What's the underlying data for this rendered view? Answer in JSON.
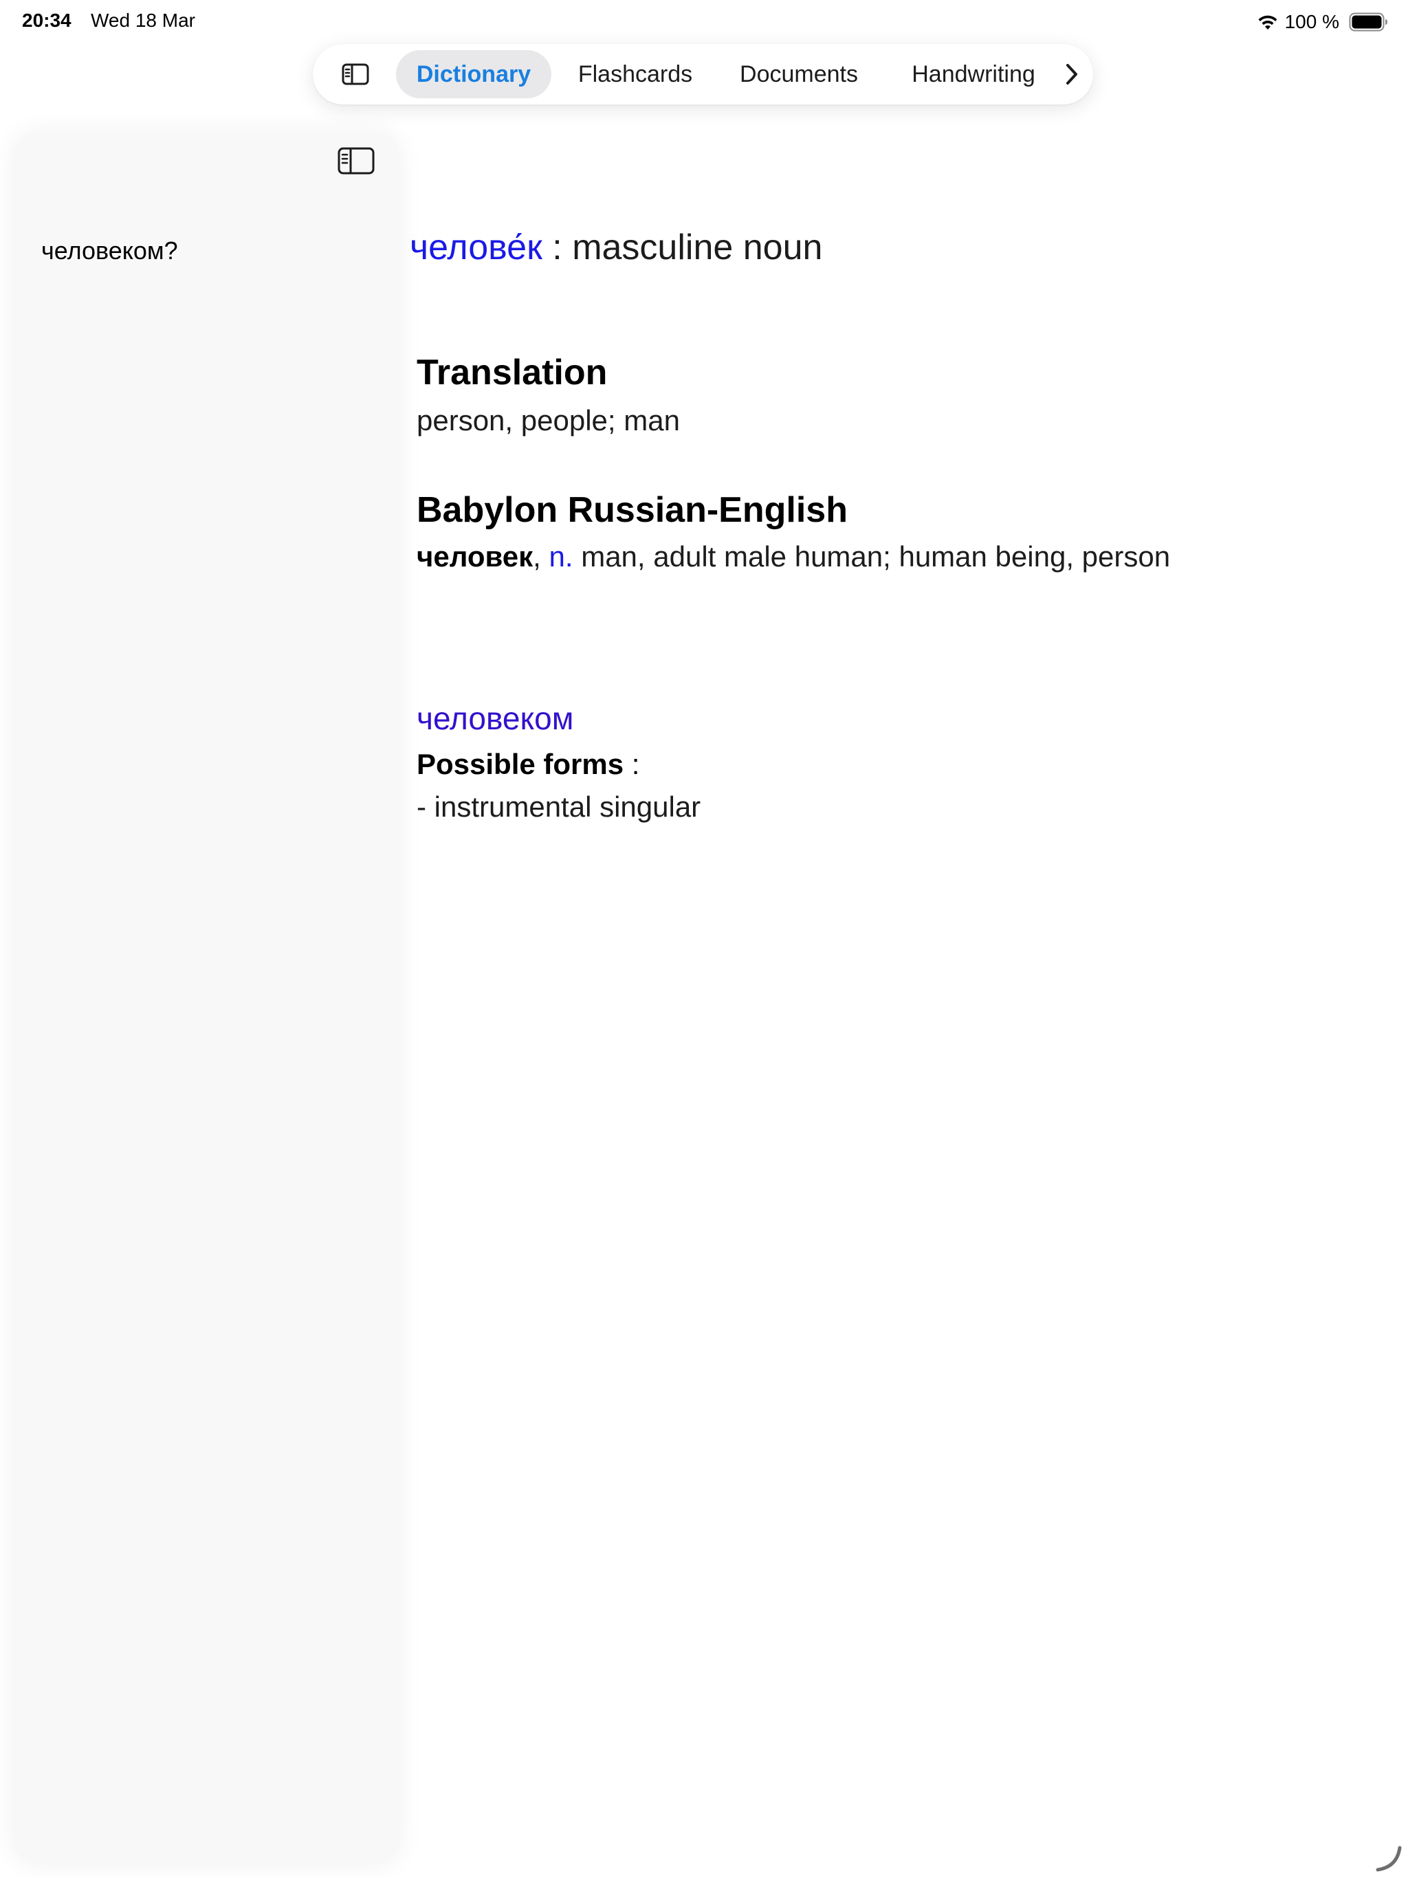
{
  "status_bar": {
    "time": "20:34",
    "date": "Wed 18 Mar",
    "battery": "100 %",
    "wifi_icon": "wifi-icon",
    "battery_icon": "battery-full-icon"
  },
  "nav": {
    "sidebar_icon": "sidebar-icon",
    "tabs": [
      {
        "label": "Dictionary",
        "active": true
      },
      {
        "label": "Flashcards",
        "active": false
      },
      {
        "label": "Documents",
        "active": false
      },
      {
        "label": "Handwriting",
        "active": false
      }
    ],
    "more_icon": "chevron-right-icon"
  },
  "sidebar": {
    "toggle_icon": "sidebar-icon",
    "query": "человеком?"
  },
  "entry": {
    "headword": "челове́к",
    "separator": " : ",
    "part_of_speech": "masculine noun",
    "translation_title": "Translation",
    "translation_text": "person, people; man",
    "babylon_title": "Babylon Russian-English",
    "babylon_word": "человек",
    "babylon_comma": ", ",
    "babylon_pos": "n.",
    "babylon_definition": " man, adult male human; human being, person",
    "form_word": "человеком",
    "forms_label": "Possible forms",
    "forms_colon": " :",
    "forms_item": "- instrumental singular"
  },
  "colors": {
    "accent_tab": "#1a7fe0",
    "headword": "#1a1ae6",
    "form_word": "#3311cc"
  }
}
